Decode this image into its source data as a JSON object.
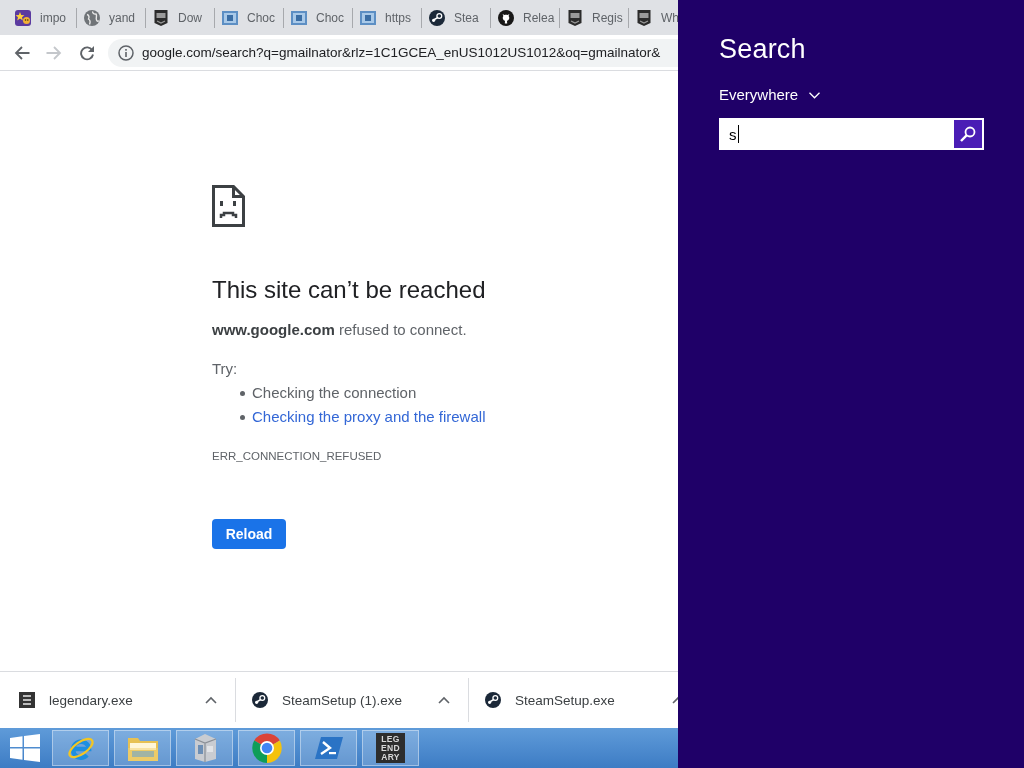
{
  "browser": {
    "tabs": [
      {
        "title": "impo",
        "kind": "sticker"
      },
      {
        "title": "yand",
        "kind": "globe"
      },
      {
        "title": "Dow",
        "kind": "shield"
      },
      {
        "title": "Choc",
        "kind": "tile"
      },
      {
        "title": "Choc",
        "kind": "tile"
      },
      {
        "title": "https",
        "kind": "tile"
      },
      {
        "title": "Stea",
        "kind": "disc"
      },
      {
        "title": "Relea",
        "kind": "cat"
      },
      {
        "title": "Regis",
        "kind": "shield"
      },
      {
        "title": "Wh",
        "kind": "shield"
      }
    ],
    "nav_buttons": [
      {
        "kind": "back",
        "disabled": false
      },
      {
        "kind": "forward",
        "disabled": true
      },
      {
        "kind": "reload",
        "disabled": false
      }
    ],
    "address": "google.com/search?q=gmailnator&rlz=1C1GCEA_enUS1012US1012&oq=gmailnator&",
    "error_page": {
      "heading": "This site can’t be reached",
      "message": "**www.google.com** refused to connect.",
      "try_label": "Try:",
      "suggestions": [
        {
          "text": "Checking the connection",
          "kind": "text"
        },
        {
          "text": "Checking the proxy and the firewall",
          "kind": "link"
        }
      ],
      "code": "ERR_CONNECTION_REFUSED",
      "button": "Reload"
    },
    "downloads": [
      {
        "name": "legendary.exe",
        "kind": "tile"
      },
      {
        "name": "SteamSetup (1).exe",
        "kind": "disc"
      },
      {
        "name": "SteamSetup.exe",
        "kind": "disc"
      }
    ]
  },
  "taskbar": {
    "apps": [
      {
        "kind": "e"
      },
      {
        "kind": "folder"
      },
      {
        "kind": "package"
      },
      {
        "kind": "circle"
      },
      {
        "kind": "prompt"
      },
      {
        "kind": "logo",
        "lines": [
          "LEG",
          "END",
          "ARY"
        ]
      }
    ]
  },
  "search_panel": {
    "title": "Search",
    "scope": "Everywhere",
    "query": "s"
  }
}
